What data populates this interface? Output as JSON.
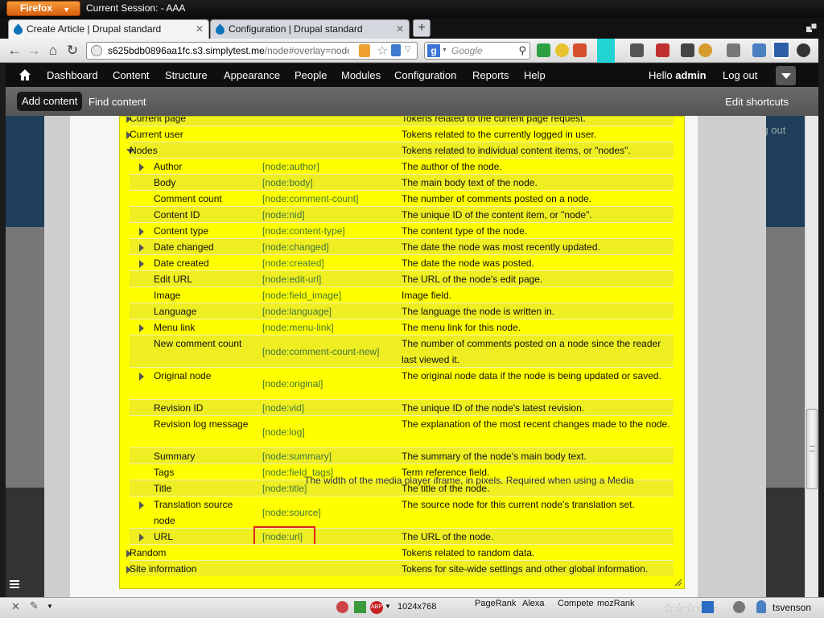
{
  "browser": {
    "app_button": "Firefox",
    "window_title": "Current Session: - AAA",
    "tabs": [
      {
        "title": "Create Article | Drupal standard",
        "active": true
      },
      {
        "title": "Configuration | Drupal standard",
        "active": false
      }
    ],
    "url_host": "s625bdb0896aa1fc.s3.simplytest.me",
    "url_path": "/node#overlay=node,",
    "search_placeholder": "Google"
  },
  "drupal_toolbar": {
    "menu": [
      "Dashboard",
      "Content",
      "Structure",
      "Appearance",
      "People",
      "Modules",
      "Configuration",
      "Reports",
      "Help"
    ],
    "greeting_prefix": "Hello",
    "user": "admin",
    "logout": "Log out"
  },
  "shortcuts": {
    "add_content": "Add content",
    "find_content": "Find content",
    "edit_shortcuts": "Edit shortcuts"
  },
  "background": {
    "logout": "Log out",
    "bottom_description": "The width of the media player iframe, in pixels. Required when using a Media"
  },
  "tokens": [
    {
      "name": "Current page",
      "token": "",
      "desc": "Tokens related to the current page request.",
      "level": 0,
      "expander": "closed"
    },
    {
      "name": "Current user",
      "token": "",
      "desc": "Tokens related to the currently logged in user.",
      "level": 0,
      "expander": "closed"
    },
    {
      "name": "Nodes",
      "token": "",
      "desc": "Tokens related to individual content items, or \"nodes\".",
      "level": 0,
      "expander": "open"
    },
    {
      "name": "Author",
      "token": "[node:author]",
      "desc": "The author of the node.",
      "level": 1,
      "expander": "closed"
    },
    {
      "name": "Body",
      "token": "[node:body]",
      "desc": "The main body text of the node.",
      "level": 1,
      "expander": "none"
    },
    {
      "name": "Comment count",
      "token": "[node:comment-count]",
      "desc": "The number of comments posted on a node.",
      "level": 1,
      "expander": "none"
    },
    {
      "name": "Content ID",
      "token": "[node:nid]",
      "desc": "The unique ID of the content item, or \"node\".",
      "level": 1,
      "expander": "none"
    },
    {
      "name": "Content type",
      "token": "[node:content-type]",
      "desc": "The content type of the node.",
      "level": 1,
      "expander": "closed"
    },
    {
      "name": "Date changed",
      "token": "[node:changed]",
      "desc": "The date the node was most recently updated.",
      "level": 1,
      "expander": "closed"
    },
    {
      "name": "Date created",
      "token": "[node:created]",
      "desc": "The date the node was posted.",
      "level": 1,
      "expander": "closed"
    },
    {
      "name": "Edit URL",
      "token": "[node:edit-url]",
      "desc": "The URL of the node's edit page.",
      "level": 1,
      "expander": "none"
    },
    {
      "name": "Image",
      "token": "[node:field_image]",
      "desc": "Image field.",
      "level": 1,
      "expander": "none"
    },
    {
      "name": "Language",
      "token": "[node:language]",
      "desc": "The language the node is written in.",
      "level": 1,
      "expander": "none"
    },
    {
      "name": "Menu link",
      "token": "[node:menu-link]",
      "desc": "The menu link for this node.",
      "level": 1,
      "expander": "closed"
    },
    {
      "name": "New comment count",
      "token": "[node:comment-count-new]",
      "desc": "The number of comments posted on a node since the reader last viewed it.",
      "level": 1,
      "expander": "none"
    },
    {
      "name": "Original node",
      "token": "[node:original]",
      "desc": "The original node data if the node is being updated or saved.",
      "level": 1,
      "expander": "closed"
    },
    {
      "name": "Revision ID",
      "token": "[node:vid]",
      "desc": "The unique ID of the node's latest revision.",
      "level": 1,
      "expander": "none"
    },
    {
      "name": "Revision log message",
      "token": "[node:log]",
      "desc": "The explanation of the most recent changes made to the node.",
      "level": 1,
      "expander": "none"
    },
    {
      "name": "Summary",
      "token": "[node:summary]",
      "desc": "The summary of the node's main body text.",
      "level": 1,
      "expander": "none"
    },
    {
      "name": "Tags",
      "token": "[node:field_tags]",
      "desc": "Term reference field.",
      "level": 1,
      "expander": "none"
    },
    {
      "name": "Title",
      "token": "[node:title]",
      "desc": "The title of the node.",
      "level": 1,
      "expander": "none"
    },
    {
      "name": "Translation source node",
      "token": "[node:source]",
      "desc": "The source node for this current node's translation set.",
      "level": 1,
      "expander": "closed"
    },
    {
      "name": "URL",
      "token": "[node:url]",
      "desc": "The URL of the node.",
      "level": 1,
      "expander": "closed",
      "highlighted": true
    },
    {
      "name": "Random",
      "token": "",
      "desc": "Tokens related to random data.",
      "level": 0,
      "expander": "closed"
    },
    {
      "name": "Site information",
      "token": "",
      "desc": "Tokens for site-wide settings and other global information.",
      "level": 0,
      "expander": "closed"
    }
  ],
  "statusbar": {
    "resolution": "1024x768",
    "pagerank": "PageRank",
    "alexa": "Alexa",
    "compete": "Compete",
    "mozrank": "mozRank",
    "user": "tsvenson"
  },
  "colors": {
    "token_panel_bg": "#ffff00",
    "token_text": "#43753c",
    "highlight_border": "#e0231d",
    "firefox_orange": "#e8781e"
  }
}
